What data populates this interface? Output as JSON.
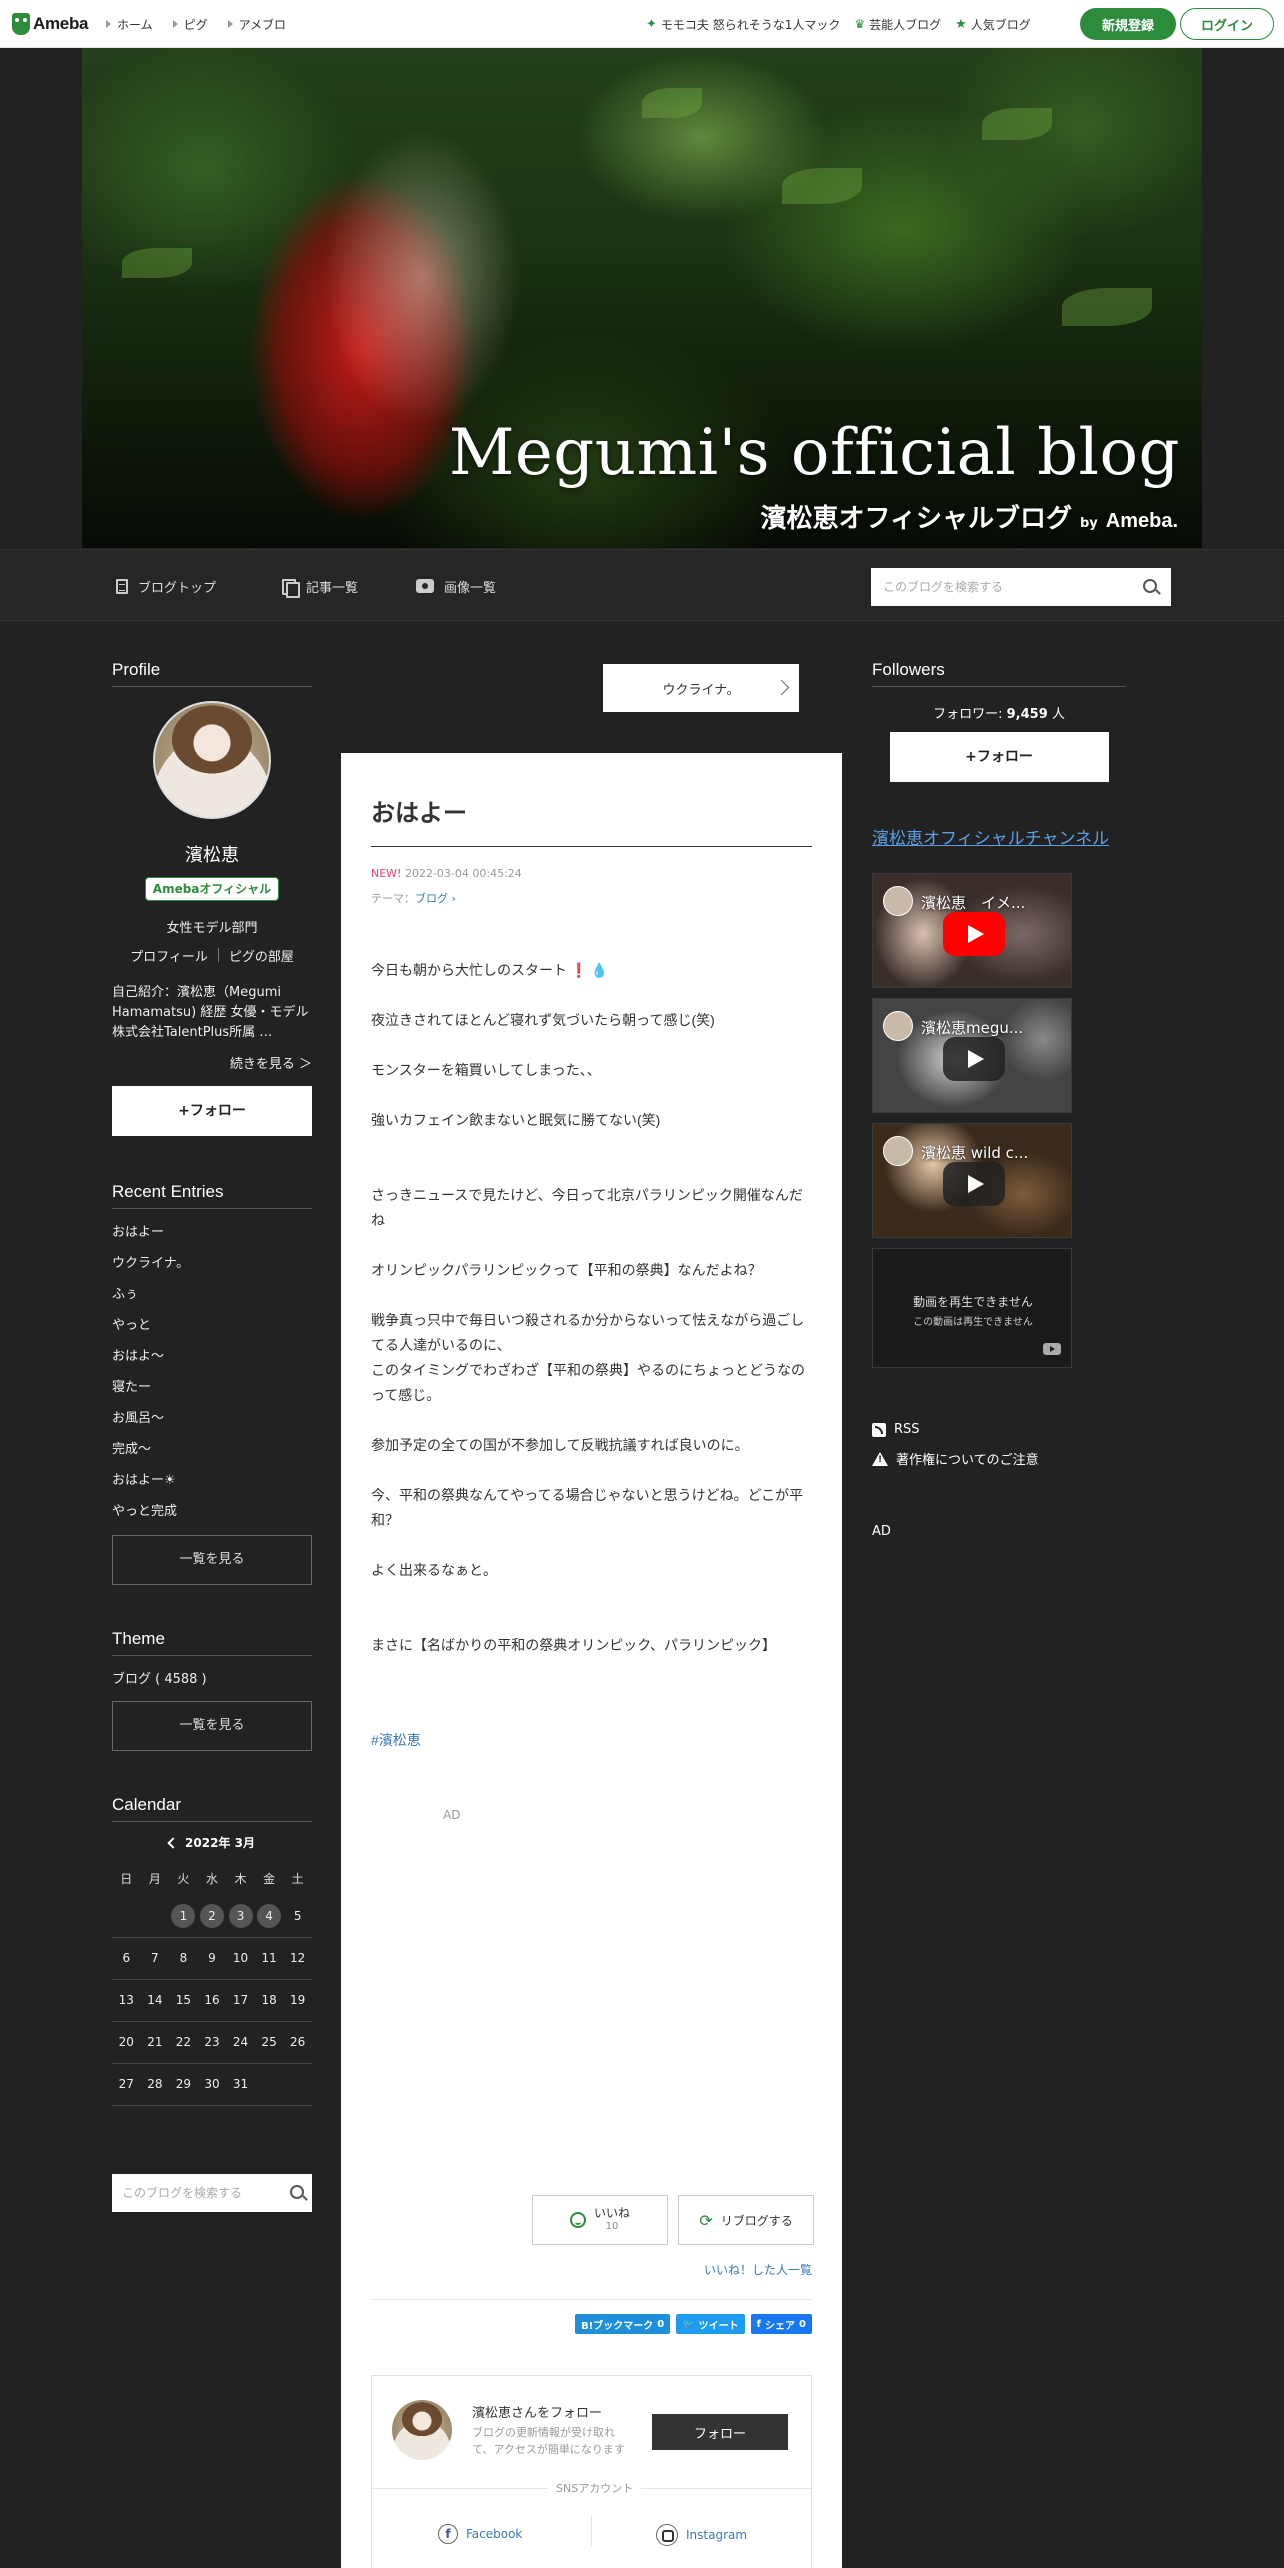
{
  "header": {
    "logo": "Ameba",
    "nav": [
      "ホーム",
      "ピグ",
      "アメブロ"
    ],
    "links": [
      {
        "icon": "star-icon",
        "label": "モモコ夫 怒られそうな1人マック"
      },
      {
        "icon": "crown-icon",
        "label": "芸能人ブログ"
      },
      {
        "icon": "star-icon",
        "label": "人気ブログ"
      }
    ],
    "register": "新規登録",
    "login": "ログイン"
  },
  "hero": {
    "title": "Megumi's official blog",
    "subtitle": "濱松恵オフィシャルブログ",
    "by": "by",
    "brand": "Ameba."
  },
  "blog_nav": {
    "tabs": [
      "ブログトップ",
      "記事一覧",
      "画像一覧"
    ],
    "search_placeholder": "このブログを検索する"
  },
  "profile": {
    "section_title": "Profile",
    "name": "濱松恵",
    "badge": "Amebaオフィシャル",
    "category": "女性モデル部門",
    "links": [
      "プロフィール",
      "ピグの部屋"
    ],
    "intro": "自己紹介：濱松恵（Megumi Hamamatsu) 経歴 女優・モデル 株式会社TalentPlus所属 …",
    "more": "続きを見る ＞",
    "follow": "+フォロー"
  },
  "recent": {
    "section_title": "Recent Entries",
    "items": [
      "おはよー",
      "ウクライナ。",
      "ふぅ",
      "やっと",
      "おはよ～",
      "寝たー",
      "お風呂～",
      "完成～",
      "おはよー☀",
      "やっと完成"
    ],
    "list_button": "一覧を見る"
  },
  "theme": {
    "section_title": "Theme",
    "item": "ブログ ( 4588 )",
    "list_button": "一覧を見る"
  },
  "calendar": {
    "section_title": "Calendar",
    "month": "2022年 3月",
    "weekdays": [
      "日",
      "月",
      "火",
      "水",
      "木",
      "金",
      "土"
    ],
    "weeks": [
      [
        "",
        "",
        "1",
        "2",
        "3",
        "4",
        "5"
      ],
      [
        "6",
        "7",
        "8",
        "9",
        "10",
        "11",
        "12"
      ],
      [
        "13",
        "14",
        "15",
        "16",
        "17",
        "18",
        "19"
      ],
      [
        "20",
        "21",
        "22",
        "23",
        "24",
        "25",
        "26"
      ],
      [
        "27",
        "28",
        "29",
        "30",
        "31",
        "",
        ""
      ]
    ],
    "days_with_posts": [
      "1",
      "2",
      "3",
      "4"
    ]
  },
  "left_search": {
    "placeholder": "このブログを検索する"
  },
  "prev_entry": "ウクライナ。",
  "article": {
    "title": "おはよー",
    "new_label": "NEW!",
    "date": "2022-03-04 00:45:24",
    "theme_label": "テーマ：",
    "theme_link": "ブログ",
    "lines": [
      "今日も朝から大忙しのスタート",
      "夜泣きされてほとんど寝れず気づいたら朝って感じ(笑)",
      "モンスターを箱買いしてしまった、、",
      "強いカフェイン飲まないと眠気に勝てない(笑)",
      "さっきニュースで見たけど、今日って北京パラリンピック開催なんだね",
      "オリンピックパラリンピックって【平和の祭典】なんだよね？",
      "戦争真っ只中で毎日いつ殺されるか分からないって怯えながら過ごしてる人達がいるのに、",
      "このタイミングでわざわざ【平和の祭典】やるのにちょっとどうなのって感じ。",
      "参加予定の全ての国が不参加して反戦抗議すれば良いのに。",
      "今、平和の祭典なんてやってる場合じゃないと思うけどね。どこが平和？",
      "よく出来るなぁと。",
      "まさに【名ばかりの平和の祭典オリンピック、パラリンピック】"
    ],
    "hashtag": "#濱松恵",
    "ad": "AD",
    "like_label": "いいね",
    "like_count": "10",
    "reblog_label": "リブログする",
    "liked_list": "いいね！した人一覧",
    "share": {
      "hatena": "B!ブックマーク",
      "hatena_count": "0",
      "tweet": "ツイート",
      "facebook": "シェア",
      "facebook_count": "0"
    },
    "follow_box": {
      "name": "濱松恵さんをフォロー",
      "desc": "ブログの更新情報が受け取れて、アクセスが簡単になります",
      "button": "フォロー",
      "sns_label": "SNSアカウント",
      "facebook": "Facebook",
      "instagram": "Instagram"
    }
  },
  "followers": {
    "section_title": "Followers",
    "label": "フォロワー:",
    "count": "9,459",
    "unit": "人",
    "follow": "+フォロー"
  },
  "channel": "濱松恵オフィシャルチャンネル",
  "videos": [
    {
      "title": "濱松恵　イメ..."
    },
    {
      "title": "濱松恵megu..."
    },
    {
      "title": "濱松恵 wild c..."
    }
  ],
  "video_error": {
    "line1": "動画を再生できません",
    "line2": "この動画は再生できません"
  },
  "rss": "RSS",
  "copyright_notice": "著作権についてのご注意",
  "ad_right": "AD"
}
